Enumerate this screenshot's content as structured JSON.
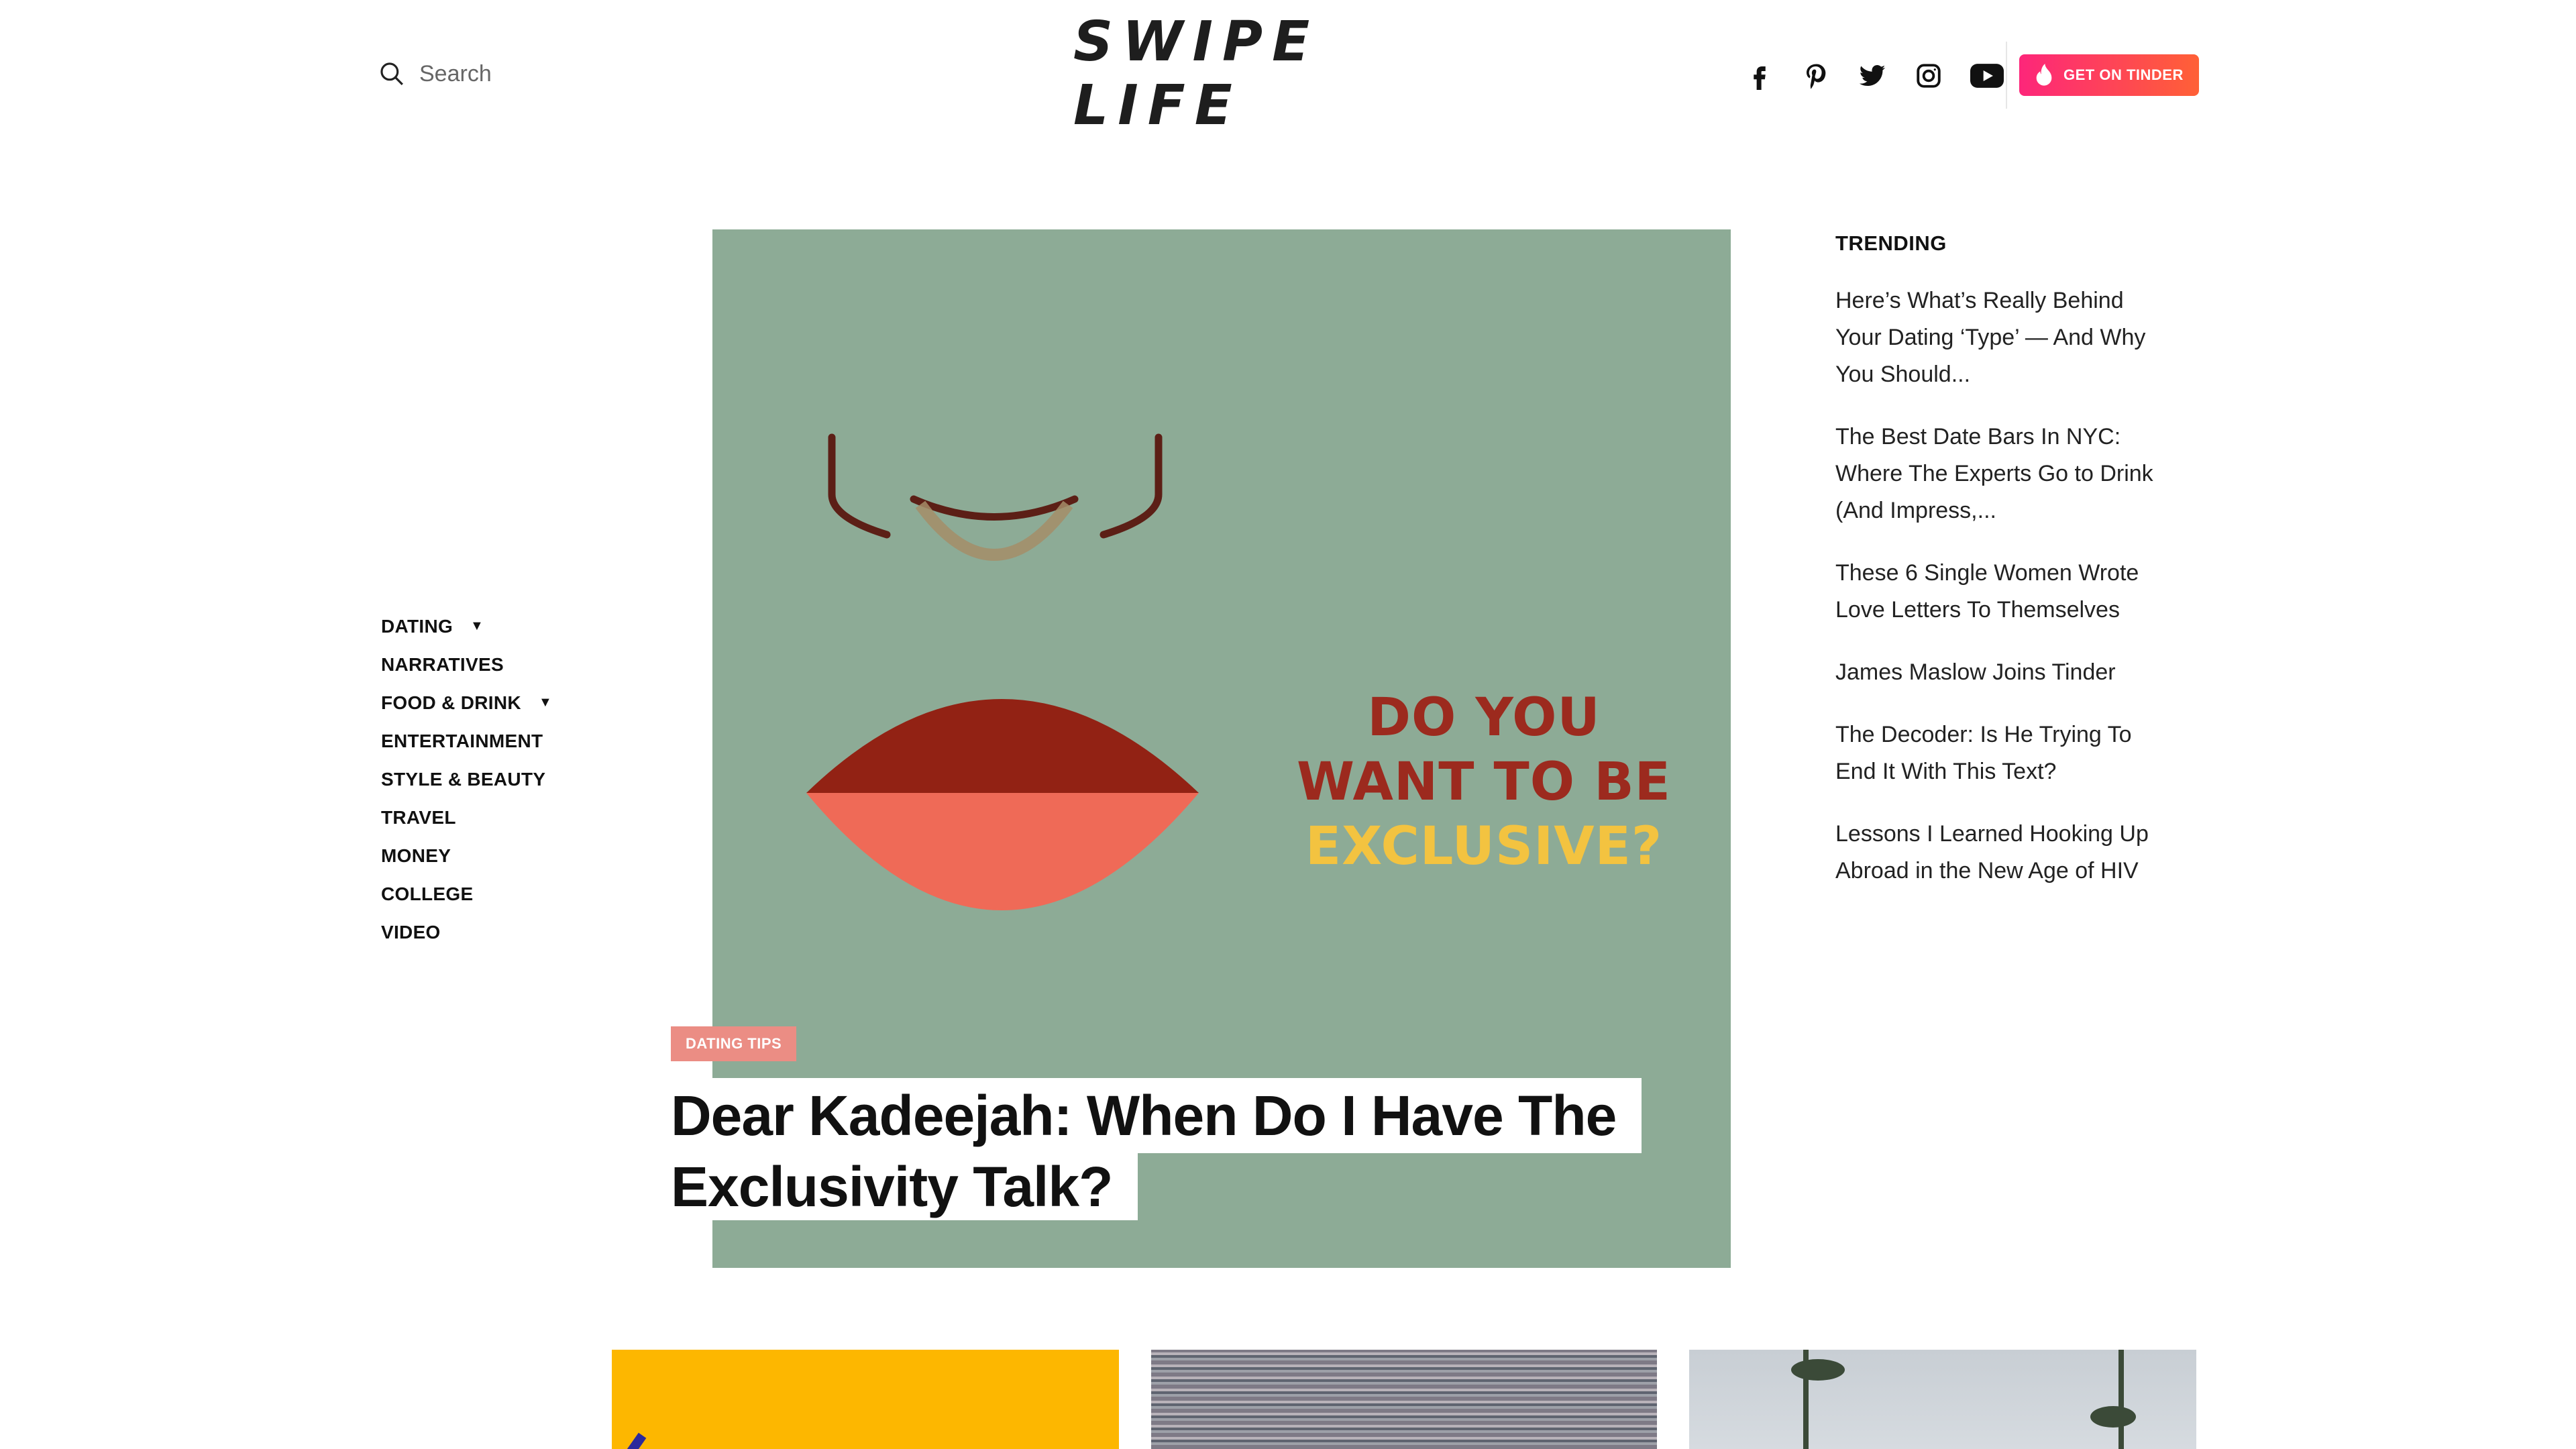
{
  "search": {
    "placeholder": "Search"
  },
  "logo": {
    "text": "SWIPE LIFE"
  },
  "socials": [
    "facebook-icon",
    "pinterest-icon",
    "twitter-icon",
    "instagram-icon",
    "youtube-icon"
  ],
  "cta": {
    "label": "GET ON TINDER",
    "color_start": "#fd267a",
    "color_end": "#ff6036"
  },
  "nav": {
    "items": [
      {
        "label": "DATING",
        "caret": "▼"
      },
      {
        "label": "NARRATIVES",
        "caret": ""
      },
      {
        "label": "FOOD & DRINK",
        "caret": "▼"
      },
      {
        "label": "ENTERTAINMENT",
        "caret": ""
      },
      {
        "label": "STYLE & BEAUTY",
        "caret": ""
      },
      {
        "label": "TRAVEL",
        "caret": ""
      },
      {
        "label": "MONEY",
        "caret": ""
      },
      {
        "label": "COLLEGE",
        "caret": ""
      },
      {
        "label": "VIDEO",
        "caret": ""
      }
    ]
  },
  "hero": {
    "image_text": {
      "line1": "DO YOU",
      "line2": "WANT TO BE",
      "line3": "EXCLUSIVE?"
    },
    "tag": "DATING TIPS",
    "headline_line1": "Dear Kadeejah: When Do I Have The",
    "headline_line2": "Exclusivity Talk?",
    "bg_color": "#8dab96"
  },
  "trending": {
    "title": "TRENDING",
    "items": [
      "Here’s What’s Really Behind Your Dating ‘Type’ — And Why You Should...",
      "The Best Date Bars In NYC: Where The Experts Go to Drink (And Impress,...",
      "These 6 Single Women Wrote Love Letters To Themselves",
      "James Maslow Joins Tinder",
      "The Decoder: Is He Trying To End It With This Text?",
      "Lessons I Learned Hooking Up Abroad in the New Age of HIV"
    ]
  }
}
